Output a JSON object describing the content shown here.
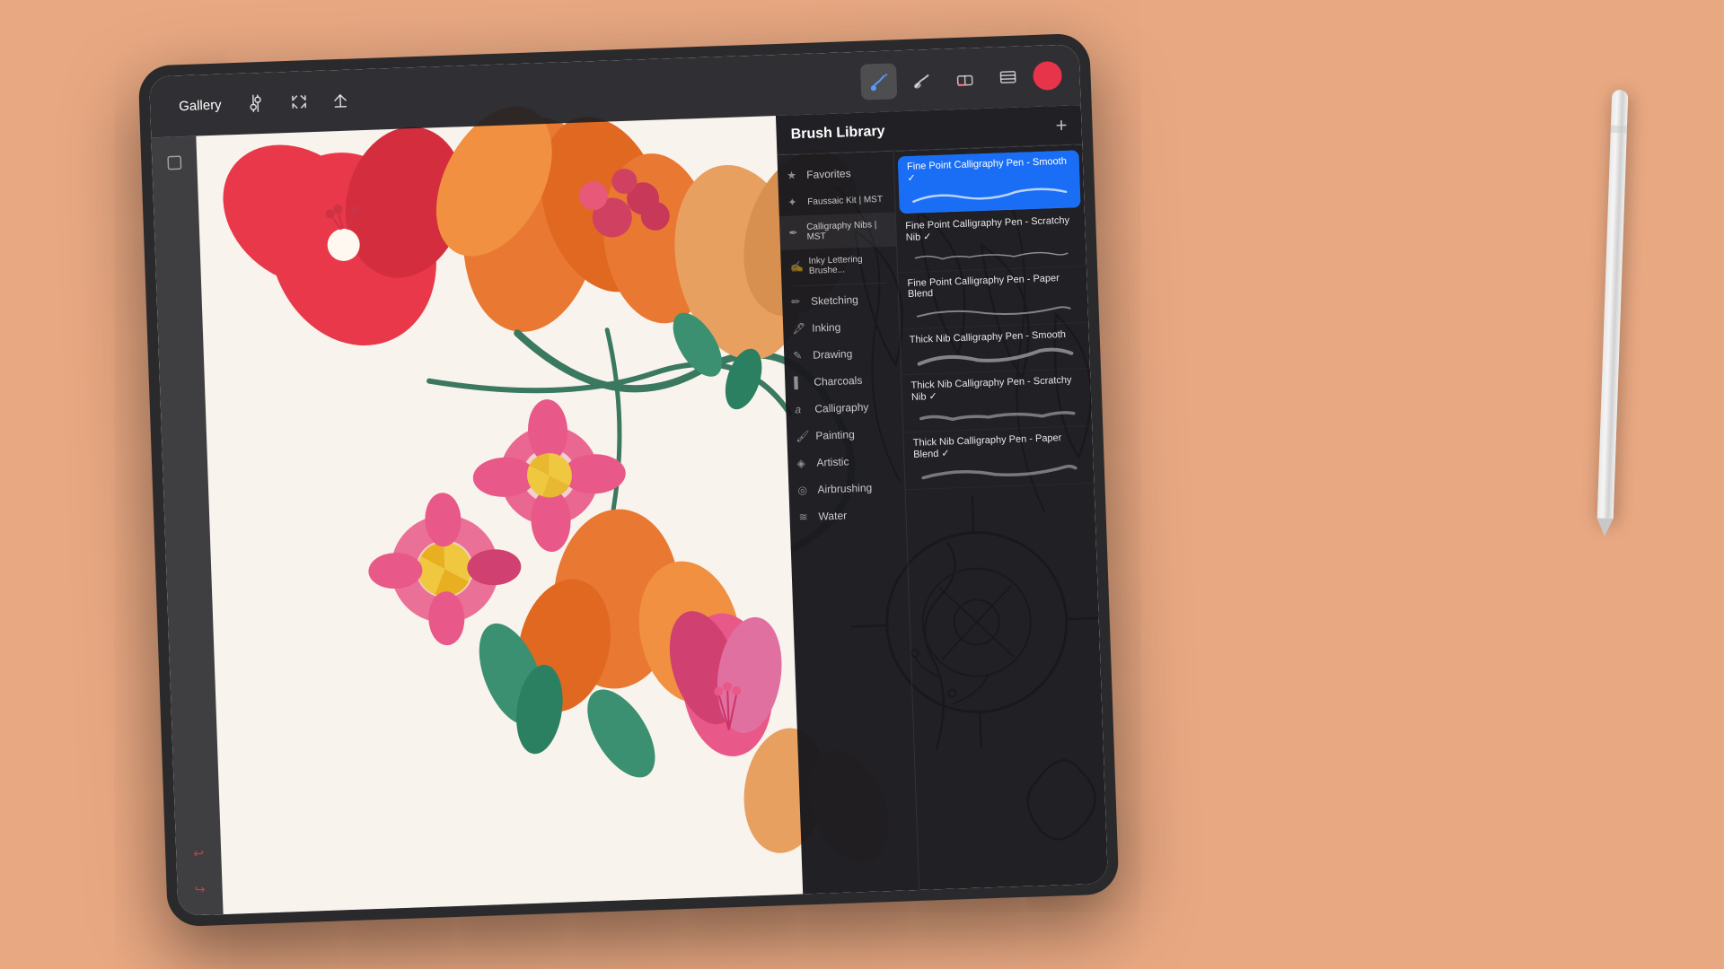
{
  "scene": {
    "bg_color": "#e8a882"
  },
  "toolbar": {
    "gallery_label": "Gallery",
    "add_label": "+",
    "brush_library_title": "Brush Library"
  },
  "categories": [
    {
      "id": "favorites",
      "label": "Favorites",
      "icon": "★",
      "sub": ""
    },
    {
      "id": "faussaic",
      "label": "Faussaic Kit | MST",
      "icon": "✦",
      "sub": ""
    },
    {
      "id": "calligraphy-nibs",
      "label": "Calligraphy Nibs | MST",
      "icon": "✒",
      "sub": ""
    },
    {
      "id": "inking-brushes",
      "label": "Inky Lettering Brushe...",
      "icon": "🖊",
      "sub": ""
    },
    {
      "id": "sketching",
      "label": "Sketching",
      "icon": "✏",
      "sub": ""
    },
    {
      "id": "inking",
      "label": "Inking",
      "icon": "🖋",
      "sub": ""
    },
    {
      "id": "drawing",
      "label": "Drawing",
      "icon": "✎",
      "sub": ""
    },
    {
      "id": "charcoals",
      "label": "Charcoals",
      "icon": "▌",
      "sub": ""
    },
    {
      "id": "calligraphy",
      "label": "Calligraphy",
      "icon": "𝒶",
      "sub": ""
    },
    {
      "id": "painting",
      "label": "Painting",
      "icon": "🖌",
      "sub": ""
    },
    {
      "id": "artistic",
      "label": "Artistic",
      "icon": "◈",
      "sub": ""
    },
    {
      "id": "airbrushing",
      "label": "Airbrushing",
      "icon": "◉",
      "sub": ""
    },
    {
      "id": "water",
      "label": "Water",
      "icon": "≋",
      "sub": ""
    }
  ],
  "brushes": [
    {
      "id": "fp-smooth",
      "name": "Fine Point Calligraphy Pen - Smooth",
      "selected": true
    },
    {
      "id": "fp-scratchy",
      "name": "Fine Point Calligraphy Pen - Scratchy Nib",
      "selected": false
    },
    {
      "id": "fp-paper",
      "name": "Fine Point Calligraphy Pen - Paper Blend",
      "selected": false
    },
    {
      "id": "tn-smooth",
      "name": "Thick Nib Calligraphy Pen - Smooth",
      "selected": false
    },
    {
      "id": "tn-scratchy",
      "name": "Thick Nib Calligraphy Pen - Scratchy Nib",
      "selected": false
    },
    {
      "id": "tn-paper",
      "name": "Thick Nib Calligraphy Pen - Paper Blend",
      "selected": false
    }
  ],
  "tools": [
    {
      "id": "brush",
      "label": "Brush",
      "symbol": "✏",
      "active": true
    },
    {
      "id": "smudge",
      "label": "Smudge",
      "symbol": "⊙",
      "active": false
    },
    {
      "id": "eraser",
      "label": "Eraser",
      "symbol": "◻",
      "active": false
    },
    {
      "id": "layers",
      "label": "Layers",
      "symbol": "⊞",
      "active": false
    }
  ],
  "color": {
    "value": "#e8344a"
  }
}
